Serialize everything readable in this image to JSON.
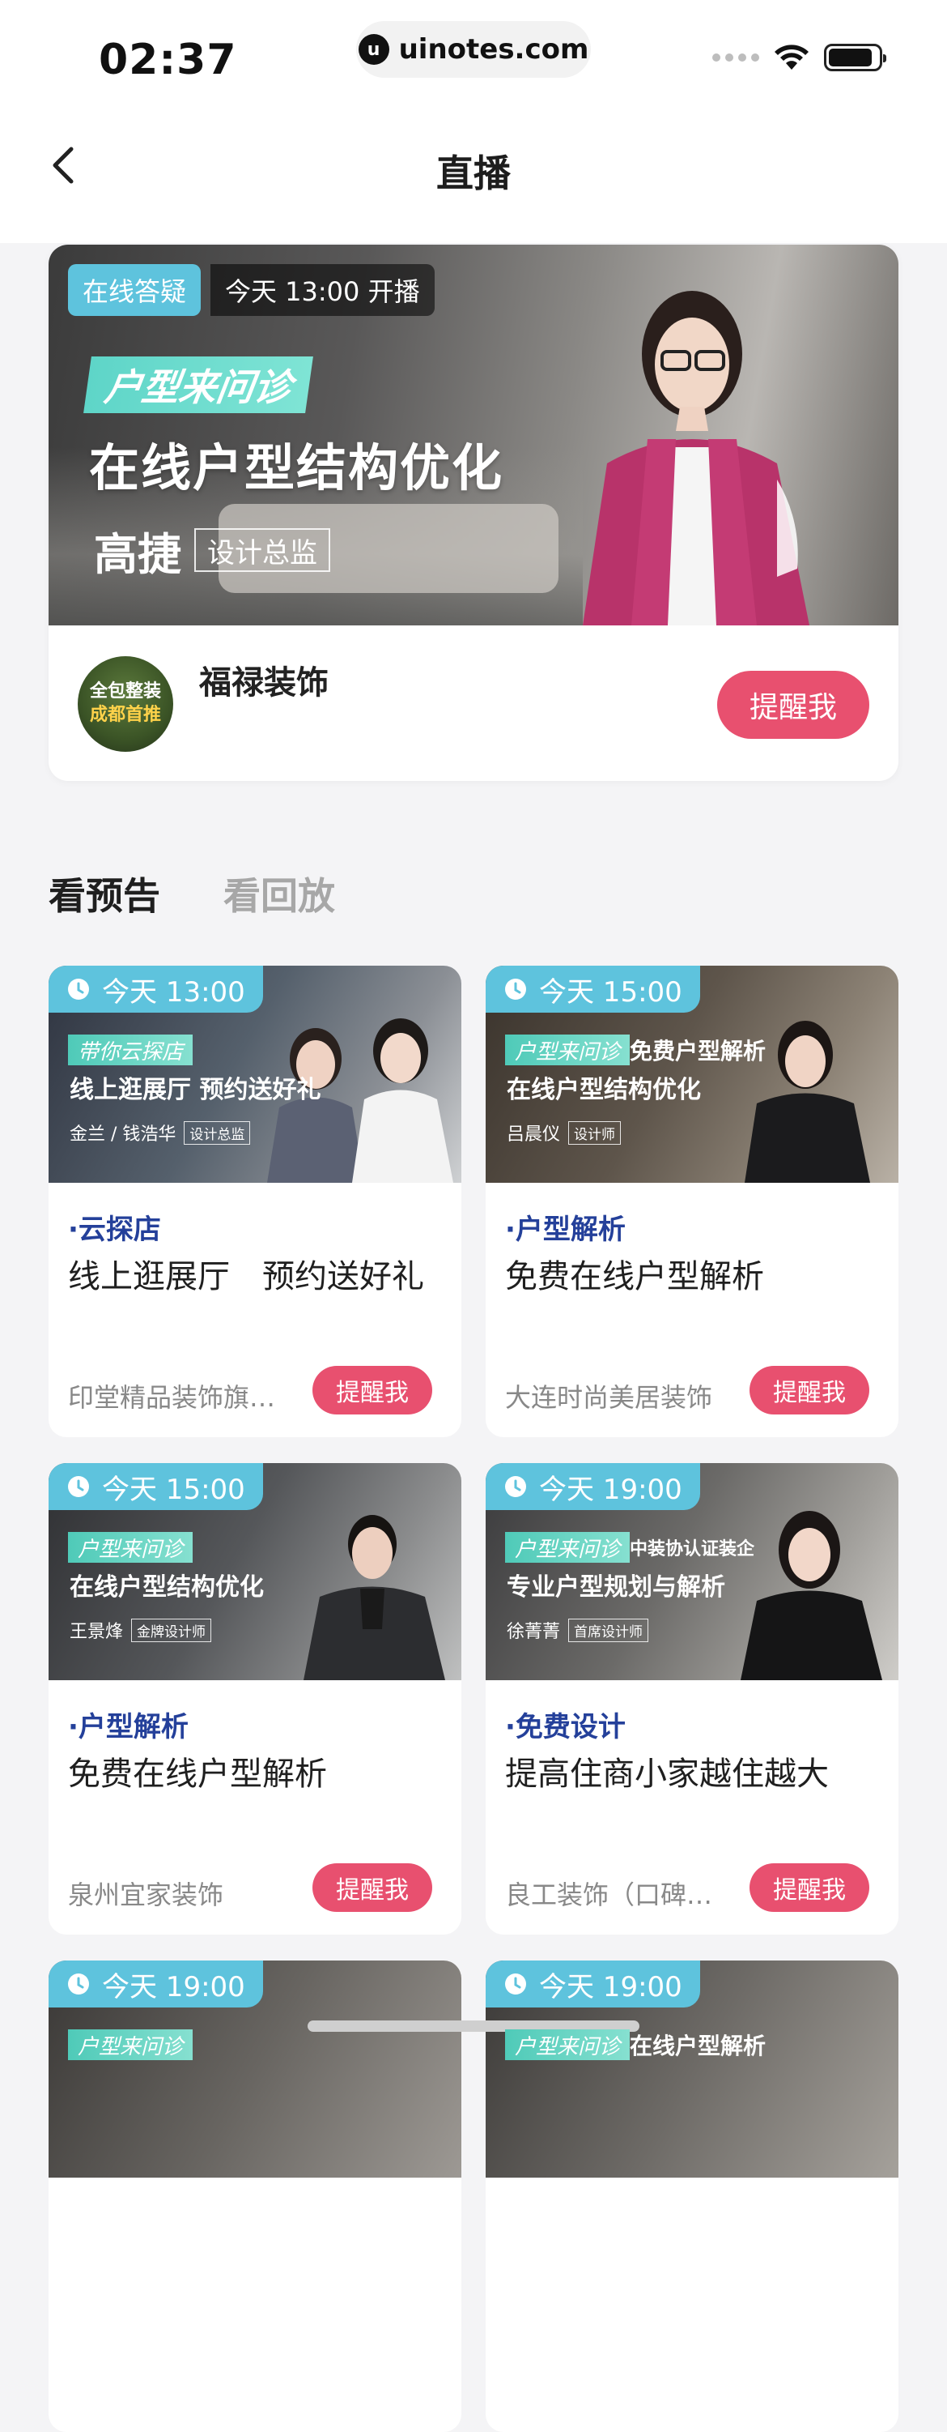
{
  "status_bar": {
    "time": "02:37",
    "url": "uinotes.com",
    "url_logo": "u"
  },
  "nav": {
    "title": "直播"
  },
  "featured": {
    "tag_online": "在线答疑",
    "tag_time": "今天 13:00 开播",
    "subtitle": "户型来问诊",
    "headline": "在线户型结构优化",
    "designer_name": "高捷",
    "designer_role": "设计总监",
    "avatar_line1": "全包整装",
    "avatar_line2": "成都首推",
    "host": "福禄装饰",
    "remind_label": "提醒我"
  },
  "tabs": [
    {
      "label": "看预告",
      "active": true
    },
    {
      "label": "看回放",
      "active": false
    }
  ],
  "cards": [
    {
      "time": "今天 13:00",
      "img_sub": "带你云探店",
      "img_sub2": "",
      "img_title": "线上逛展厅 预约送好礼",
      "img_host": "金兰 / 钱浩华",
      "img_role": "设计总监",
      "category": "·云探店",
      "title": "线上逛展厅　预约送好礼",
      "shop": "印堂精品装饰旗…",
      "remind": "提醒我"
    },
    {
      "time": "今天 15:00",
      "img_sub": "户型来问诊",
      "img_sub2": "免费户型解析",
      "img_title": "在线户型结构优化",
      "img_host": "吕晨仪",
      "img_role": "设计师",
      "category": "·户型解析",
      "title": "免费在线户型解析",
      "shop": "大连时尚美居装饰",
      "remind": "提醒我"
    },
    {
      "time": "今天 15:00",
      "img_sub": "户型来问诊",
      "img_sub2": "",
      "img_title": "在线户型结构优化",
      "img_host": "王景烽",
      "img_role": "金牌设计师",
      "category": "·户型解析",
      "title": "免费在线户型解析",
      "shop": "泉州宜家装饰",
      "remind": "提醒我"
    },
    {
      "time": "今天 19:00",
      "img_sub": "户型来问诊",
      "img_sub2": "中装协认证装企",
      "img_title": "专业户型规划与解析",
      "img_host": "徐菁菁",
      "img_role": "首席设计师",
      "category": "·免费设计",
      "title": "提高住商小家越住越大",
      "shop": "良工装饰（口碑…",
      "remind": "提醒我"
    },
    {
      "time": "今天 19:00",
      "img_sub": "户型来问诊",
      "img_sub2": ""
    },
    {
      "time": "今天 19:00",
      "img_sub": "户型来问诊",
      "img_sub2": "在线户型解析"
    }
  ],
  "colors": {
    "accent_pink": "#e8506f",
    "badge_blue": "#5ec3dd",
    "category_blue": "#24409a",
    "background": "#f4f4f6"
  }
}
